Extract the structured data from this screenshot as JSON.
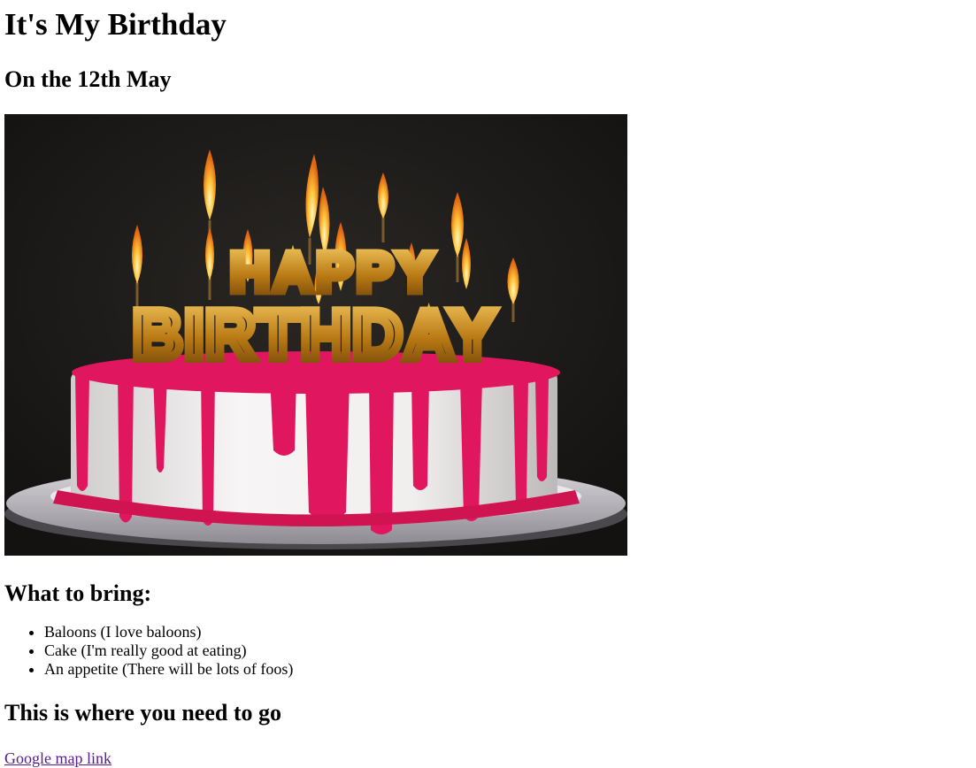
{
  "page": {
    "title": "It's My Birthday",
    "subtitle": "On the 12th May"
  },
  "image": {
    "icon": "birthday-cake-photo",
    "cake_text_top": "HAPPY",
    "cake_text_bottom": "BIRTHDAY",
    "colors": {
      "background": "#1c1a18",
      "frosting": "#f0eeee",
      "drip": "#e0175f",
      "plate": "#cfcdd2",
      "gold": "#d49a1e",
      "flame": "#ffcc33"
    }
  },
  "bring": {
    "heading": "What to bring:",
    "items": [
      "Baloons (I love baloons)",
      "Cake (I'm really good at eating)",
      "An appetite (There will be lots of foos)"
    ]
  },
  "location": {
    "heading": "This is where you need to go",
    "link_text": "Google map link"
  }
}
